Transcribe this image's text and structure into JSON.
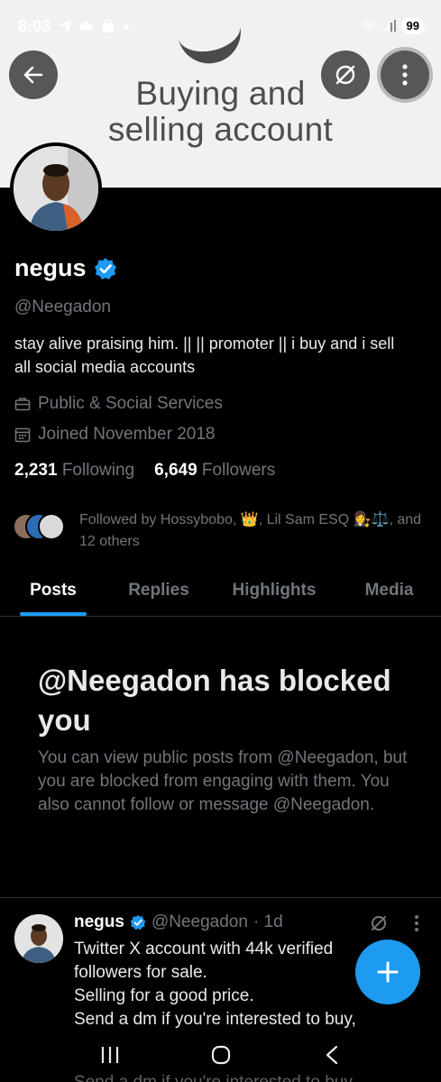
{
  "status_bar": {
    "time": "8:03",
    "battery": "99"
  },
  "banner": {
    "line1": "Buying and",
    "line2": "selling account"
  },
  "profile": {
    "name": "negus",
    "handle": "@Neegadon",
    "bio": "stay alive praising him. || || promoter || i buy and i sell all social media accounts",
    "category": "Public & Social Services",
    "joined": "Joined November 2018",
    "following_count": "2,231",
    "following_label": "Following",
    "followers_count": "6,649",
    "followers_label": "Followers",
    "followed_by": "Followed by Hossybobo, 👑, Lil Sam ESQ 👩‍⚖️⚖️, and 12 others"
  },
  "tabs": [
    {
      "label": "Posts",
      "active": true
    },
    {
      "label": "Replies",
      "active": false
    },
    {
      "label": "Highlights",
      "active": false
    },
    {
      "label": "Media",
      "active": false
    }
  ],
  "blocked": {
    "title": "@Neegadon has blocked you",
    "text": "You can view public posts from @Neegadon, but you are blocked from engaging with them. You also cannot follow or message @Neegadon."
  },
  "post": {
    "name": "negus",
    "handle": "@Neegadon",
    "time": "· 1d",
    "lines": [
      "Twitter X account with 44k verified",
      "followers for sale.",
      "Selling for a good price.",
      "Send a dm if you're interested to buy,"
    ],
    "cutoff": "Send a dm if you're interested to buy,"
  },
  "colors": {
    "accent": "#1d9bf0",
    "muted": "#71767b",
    "background": "#000000"
  },
  "icons": [
    "back-arrow-icon",
    "grok-icon",
    "more-vertical-icon",
    "verified-badge-icon",
    "briefcase-icon",
    "calendar-icon",
    "plus-icon",
    "recents-icon",
    "home-icon",
    "back-nav-icon"
  ]
}
